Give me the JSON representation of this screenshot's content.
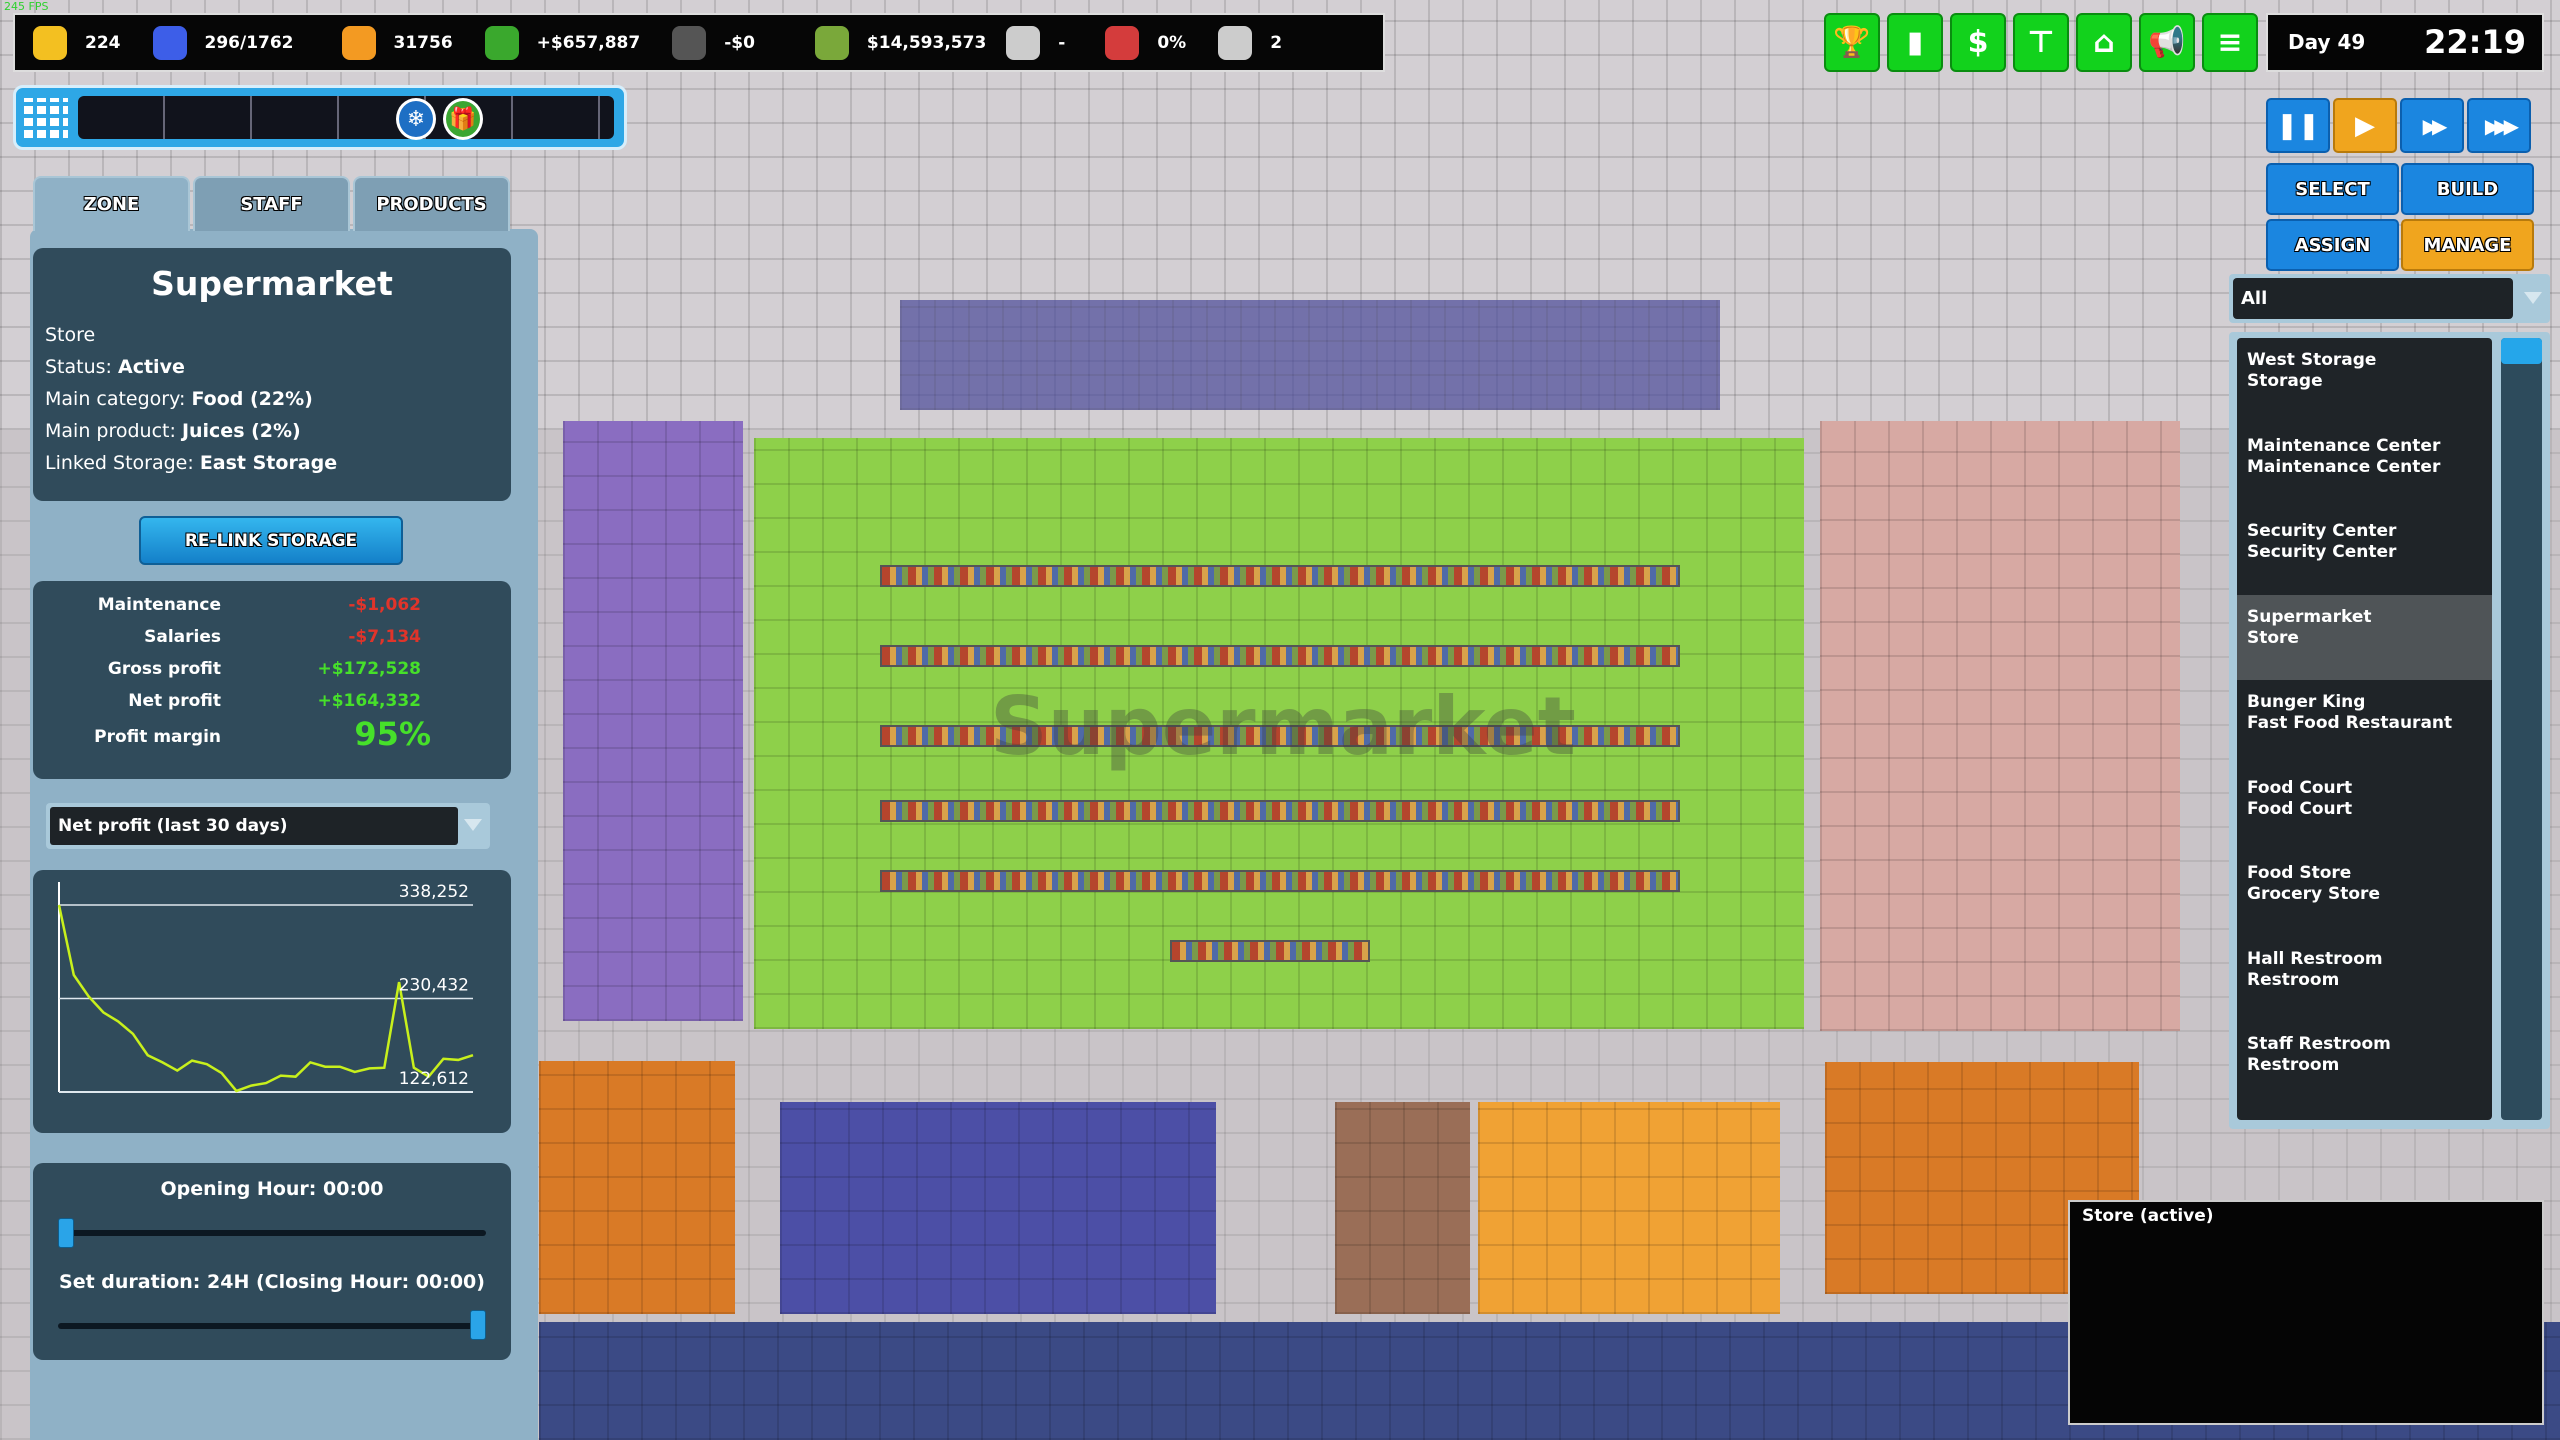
{
  "fps": "245 FPS",
  "topbar": {
    "stats": [
      {
        "icon": "smiley-icon",
        "value": "224",
        "color": "#f3c021"
      },
      {
        "icon": "car-icon",
        "value": "296/1762",
        "color": "#3d5ee8"
      },
      {
        "icon": "price-tag-icon",
        "value": "31756",
        "color": "#f39a22"
      },
      {
        "icon": "growth-chart-icon",
        "value": "+$657,887",
        "color": "#3aa82d"
      },
      {
        "icon": "money-bag-icon",
        "value": "-$0",
        "color": "#555"
      },
      {
        "icon": "cash-icon",
        "value": "$14,593,573",
        "color": "#7aa83a"
      },
      {
        "icon": "computer-icon",
        "value": "-",
        "color": "#ccc"
      },
      {
        "icon": "megaphone-icon",
        "value": "0%",
        "color": "#d43c3c"
      },
      {
        "icon": "clipboard-icon",
        "value": "2",
        "color": "#ccc"
      }
    ]
  },
  "tabs": [
    "ZONE",
    "STAFF",
    "PRODUCTS"
  ],
  "zone": {
    "name": "Supermarket",
    "type": "Store",
    "status_label": "Status:",
    "status": "Active",
    "category_label": "Main category:",
    "category": "Food (22%)",
    "product_label": "Main product:",
    "product": "Juices (2%)",
    "storage_label": "Linked Storage:",
    "storage": "East Storage",
    "relink_label": "RE-LINK STORAGE"
  },
  "finance": [
    {
      "label": "Maintenance",
      "value": "-$1,062",
      "color": "#e0342a"
    },
    {
      "label": "Salaries",
      "value": "-$7,134",
      "color": "#e0342a"
    },
    {
      "label": "Gross profit",
      "value": "+$172,528",
      "color": "#46e02a"
    },
    {
      "label": "Net profit",
      "value": "+$164,332",
      "color": "#46e02a"
    }
  ],
  "margin": {
    "label": "Profit margin",
    "value": "95%"
  },
  "chart_select": "Net profit (last 30 days)",
  "chart_data": {
    "type": "line",
    "ylim": [
      122612,
      338252
    ],
    "tick_labels": [
      "338,252",
      "230,432",
      "122,612"
    ],
    "ticks": [
      338252,
      230432,
      122612
    ],
    "grid": true,
    "line_color": "#c8f01c",
    "values": [
      338252,
      257600,
      232900,
      214400,
      204000,
      189700,
      165000,
      156800,
      147300,
      158800,
      154700,
      144400,
      123800,
      130000,
      132900,
      141500,
      140300,
      156800,
      151800,
      151800,
      145700,
      149800,
      150600,
      249400,
      150600,
      140300,
      160900,
      159600,
      165000
    ]
  },
  "hours": {
    "opening": "Opening Hour: 00:00",
    "duration": "Set duration: 24H (Closing Hour: 00:00)",
    "opening_fraction": 0,
    "duration_fraction": 1
  },
  "toolbar": {
    "buttons": [
      {
        "icon": "trophy-icon",
        "glyph": "🏆"
      },
      {
        "icon": "bar-chart-icon",
        "glyph": "▮"
      },
      {
        "icon": "dollar-icon",
        "glyph": "$"
      },
      {
        "icon": "org-chart-icon",
        "glyph": "⊤"
      },
      {
        "icon": "basket-icon",
        "glyph": "⌂"
      },
      {
        "icon": "megaphone-icon",
        "glyph": "📢"
      },
      {
        "icon": "menu-icon",
        "glyph": "≡"
      }
    ]
  },
  "clock": {
    "day": "Day 49",
    "time": "22:19"
  },
  "speed": [
    {
      "icon": "pause-icon",
      "glyph": "❚❚",
      "active": false
    },
    {
      "icon": "play-icon",
      "glyph": "▶",
      "active": true
    },
    {
      "icon": "fast-forward-icon",
      "glyph": "▶▶",
      "active": false
    },
    {
      "icon": "fastest-icon",
      "glyph": "▶▶▶",
      "active": false
    }
  ],
  "modes": {
    "select": "SELECT",
    "build": "BUILD",
    "assign": "ASSIGN",
    "manage": "MANAGE",
    "active": "MANAGE"
  },
  "filter": "All",
  "zones_list": [
    {
      "name": "West Storage",
      "type": "Storage"
    },
    {
      "name": "Maintenance Center",
      "type": "Maintenance Center"
    },
    {
      "name": "Security Center",
      "type": "Security Center"
    },
    {
      "name": "Supermarket",
      "type": "Store",
      "selected": true
    },
    {
      "name": "Bunger King",
      "type": "Fast Food Restaurant"
    },
    {
      "name": "Food Court",
      "type": "Food Court"
    },
    {
      "name": "Food Store",
      "type": "Grocery Store"
    },
    {
      "name": "Hall Restroom",
      "type": "Restroom"
    },
    {
      "name": "Staff Restroom",
      "type": "Restroom"
    }
  ],
  "tooltip": "Store (active)",
  "map_label": "Supermarket"
}
